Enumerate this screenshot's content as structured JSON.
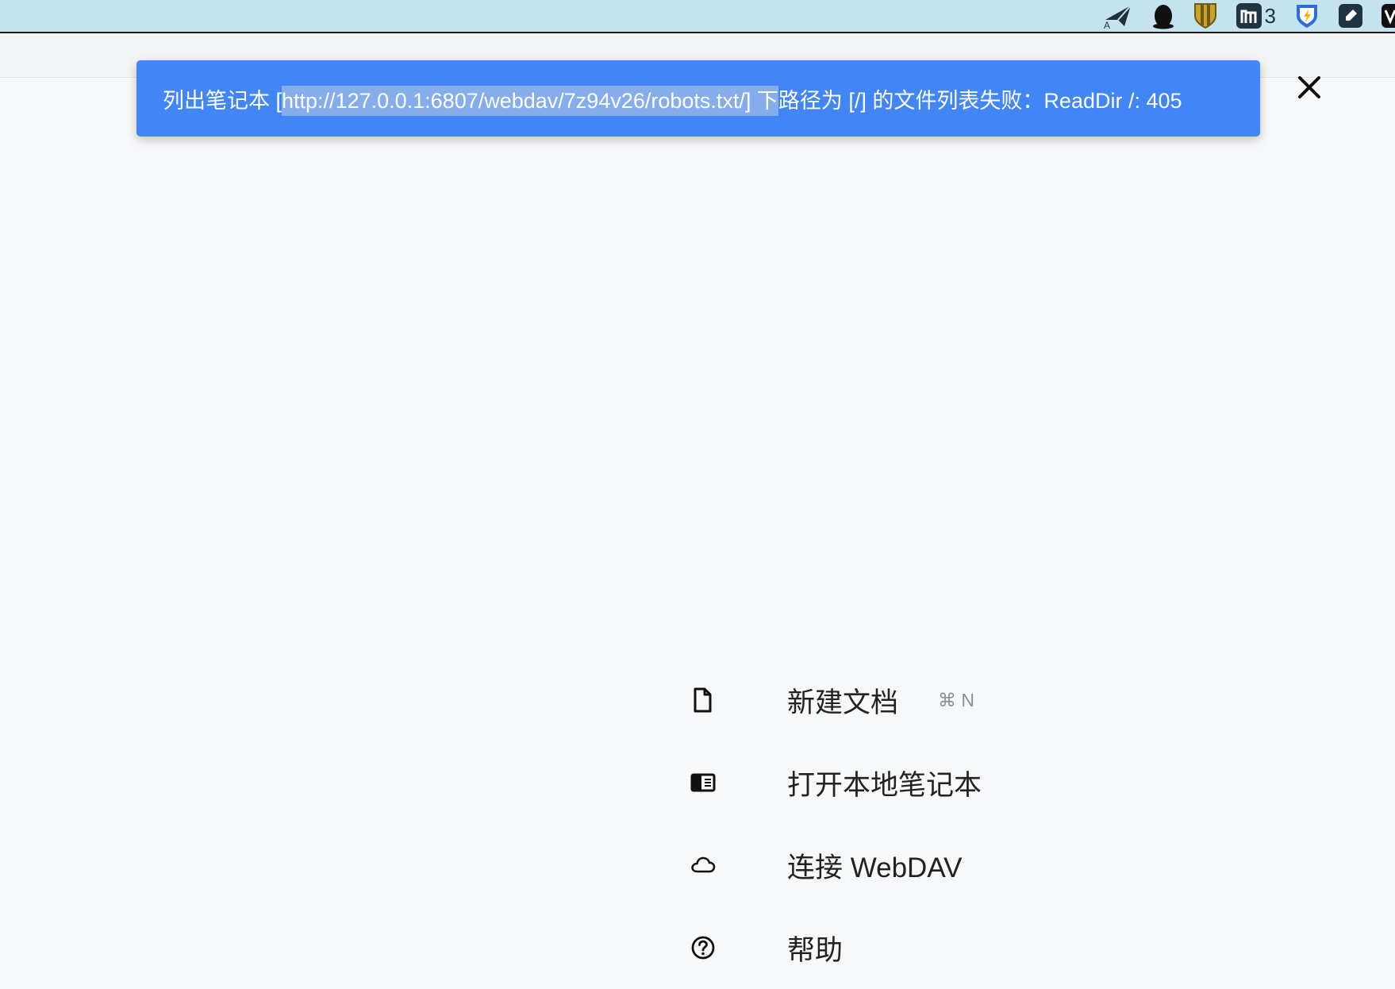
{
  "menubar": {
    "tray_icons": [
      "paper-plane-translate-icon",
      "penguin-icon",
      "shield-stripes-icon",
      "m-app-icon",
      "shield-bolt-icon",
      "note-pen-icon",
      "v-app-icon"
    ],
    "m_app_badge": "3"
  },
  "toast": {
    "prefix": "列出笔记本 [",
    "selected": "http://127.0.0.1:6807/webdav/7z94v26/robots.txt/] 下",
    "suffix": "路径为 [/] 的文件列表失败：ReadDir /: 405",
    "close_icon": "close-icon",
    "color": "#4285f4"
  },
  "menu": {
    "items": [
      {
        "icon": "file-icon",
        "label": "新建文档",
        "shortcut": "⌘ N"
      },
      {
        "icon": "notebook-icon",
        "label": "打开本地笔记本"
      },
      {
        "icon": "cloud-icon",
        "label": "连接 WebDAV"
      },
      {
        "icon": "help-circle-icon",
        "label": "帮助"
      }
    ]
  }
}
